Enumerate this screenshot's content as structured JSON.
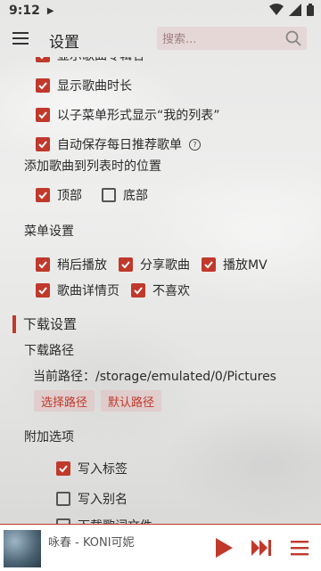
{
  "status_bar": {
    "time": "9:12"
  },
  "header": {
    "title": "设置",
    "search_placeholder": "搜索..."
  },
  "settings": {
    "show_lyric_partial": "显示歌曲专辑名",
    "show_duration": "显示歌曲时长",
    "submenu_my_list": "以子菜单形式显示“我的列表”",
    "autosave_daily": "自动保存每日推荐歌单",
    "add_position_label": "添加歌曲到列表时的位置",
    "position_top": "顶部",
    "position_bottom": "底部",
    "menu_settings_label": "菜单设置",
    "menu_items": {
      "play_later": "稍后播放",
      "share_song": "分享歌曲",
      "play_mv": "播放MV",
      "song_detail": "歌曲详情页",
      "dislike": "不喜欢"
    }
  },
  "download": {
    "section_title": "下载设置",
    "path_label": "下载路径",
    "current_path": "当前路径：/storage/emulated/0/Pictures",
    "choose_path_btn": "选择路径",
    "default_path_btn": "默认路径",
    "extra_label": "附加选项",
    "write_tags": "写入标签",
    "write_alias": "写入别名",
    "download_lyrics_partial": "下载歌词文件"
  },
  "player": {
    "song": "咏春 - KONI可妮"
  },
  "colors": {
    "accent": "#c0392b"
  }
}
